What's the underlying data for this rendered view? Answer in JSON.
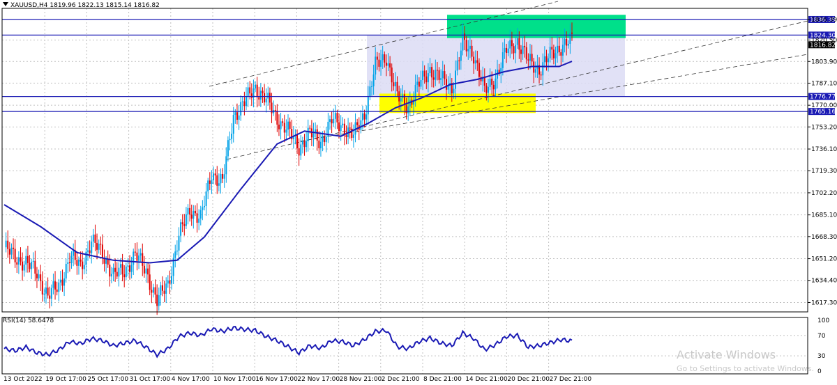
{
  "header": {
    "symbol": "XAUUSD,H4",
    "ohlc": [
      "1819.96",
      "1822.13",
      "1815.14",
      "1816.82"
    ]
  },
  "rsi": {
    "label": "RSI(14) 58.6478",
    "levels": [
      100,
      70,
      30,
      0
    ]
  },
  "watermark": {
    "title": "Activate Windows",
    "subtitle": "Go to Settings to activate Windows."
  },
  "chart_data": {
    "type": "candlestick",
    "price_axis": {
      "ylim": [
        1610,
        1845
      ],
      "ticks": [
        "1836.39",
        "1820.50",
        "1803.90",
        "1787.10",
        "1770.00",
        "1753.20",
        "1736.10",
        "1719.30",
        "1702.20",
        "1685.10",
        "1668.30",
        "1651.20",
        "1634.40",
        "1617.30"
      ]
    },
    "current_price": "1816.82",
    "horizontal_lines": [
      {
        "value": 1836.39,
        "label": "1836.39"
      },
      {
        "value": 1824.3,
        "label": "1824.30"
      },
      {
        "value": 1776.77,
        "label": "1776.77"
      },
      {
        "value": 1765.16,
        "label": "1765.16"
      }
    ],
    "x_labels": [
      "13 Oct 2022",
      "19 Oct 17:00",
      "25 Oct 17:00",
      "31 Oct 17:00",
      "4 Nov 17:00",
      "10 Nov 17:00",
      "16 Nov 17:00",
      "22 Nov 17:00",
      "28 Nov 21:00",
      "2 Dec 21:00",
      "8 Dec 21:00",
      "14 Dec 21:00",
      "20 Dec 21:00",
      "27 Dec 21:00"
    ],
    "colors": {
      "up": "#00a2e8",
      "down": "#e00000",
      "ma": "#1a1ab4",
      "hline": "#1a1ab4",
      "green_zone": "#00e08a",
      "yellow_zone": "#ffff00",
      "range_box": "#dcdcf5"
    },
    "close_path": [
      [
        0,
        1660
      ],
      [
        6,
        1652
      ],
      [
        12,
        1648
      ],
      [
        18,
        1640
      ],
      [
        24,
        1622
      ],
      [
        30,
        1630
      ],
      [
        36,
        1652
      ],
      [
        42,
        1646
      ],
      [
        48,
        1664
      ],
      [
        54,
        1656
      ],
      [
        60,
        1638
      ],
      [
        66,
        1642
      ],
      [
        72,
        1654
      ],
      [
        78,
        1642
      ],
      [
        84,
        1618
      ],
      [
        90,
        1632
      ],
      [
        96,
        1668
      ],
      [
        102,
        1690
      ],
      [
        108,
        1682
      ],
      [
        114,
        1718
      ],
      [
        120,
        1710
      ],
      [
        126,
        1762
      ],
      [
        132,
        1772
      ],
      [
        138,
        1784
      ],
      [
        144,
        1774
      ],
      [
        150,
        1760
      ],
      [
        156,
        1750
      ],
      [
        162,
        1738
      ],
      [
        168,
        1748
      ],
      [
        174,
        1742
      ],
      [
        180,
        1758
      ],
      [
        186,
        1754
      ],
      [
        192,
        1746
      ],
      [
        198,
        1764
      ],
      [
        204,
        1800
      ],
      [
        210,
        1808
      ],
      [
        216,
        1776
      ],
      [
        222,
        1770
      ],
      [
        228,
        1786
      ],
      [
        234,
        1798
      ],
      [
        240,
        1790
      ],
      [
        246,
        1784
      ],
      [
        252,
        1818
      ],
      [
        258,
        1810
      ],
      [
        264,
        1780
      ],
      [
        270,
        1792
      ],
      [
        276,
        1812
      ],
      [
        282,
        1820
      ],
      [
        288,
        1804
      ],
      [
        294,
        1798
      ],
      [
        300,
        1808
      ],
      [
        306,
        1816
      ],
      [
        312,
        1820
      ]
    ],
    "ma_path": [
      [
        0,
        1693
      ],
      [
        20,
        1676
      ],
      [
        40,
        1656
      ],
      [
        60,
        1650
      ],
      [
        80,
        1648
      ],
      [
        95,
        1650
      ],
      [
        110,
        1668
      ],
      [
        130,
        1705
      ],
      [
        150,
        1740
      ],
      [
        165,
        1750
      ],
      [
        185,
        1746
      ],
      [
        200,
        1756
      ],
      [
        215,
        1768
      ],
      [
        230,
        1776
      ],
      [
        245,
        1786
      ],
      [
        260,
        1790
      ],
      [
        275,
        1796
      ],
      [
        290,
        1800
      ],
      [
        305,
        1800
      ],
      [
        312,
        1804
      ]
    ],
    "rsi_series": [
      [
        0,
        44
      ],
      [
        6,
        40
      ],
      [
        12,
        47
      ],
      [
        18,
        36
      ],
      [
        24,
        32
      ],
      [
        30,
        42
      ],
      [
        36,
        58
      ],
      [
        42,
        54
      ],
      [
        48,
        64
      ],
      [
        54,
        60
      ],
      [
        60,
        50
      ],
      [
        66,
        55
      ],
      [
        72,
        60
      ],
      [
        78,
        47
      ],
      [
        84,
        32
      ],
      [
        90,
        44
      ],
      [
        96,
        68
      ],
      [
        102,
        75
      ],
      [
        108,
        70
      ],
      [
        114,
        83
      ],
      [
        120,
        78
      ],
      [
        126,
        85
      ],
      [
        132,
        82
      ],
      [
        138,
        80
      ],
      [
        144,
        68
      ],
      [
        150,
        60
      ],
      [
        156,
        48
      ],
      [
        162,
        36
      ],
      [
        168,
        50
      ],
      [
        174,
        45
      ],
      [
        180,
        60
      ],
      [
        186,
        58
      ],
      [
        192,
        50
      ],
      [
        198,
        62
      ],
      [
        204,
        78
      ],
      [
        210,
        80
      ],
      [
        216,
        48
      ],
      [
        222,
        44
      ],
      [
        228,
        58
      ],
      [
        234,
        65
      ],
      [
        240,
        55
      ],
      [
        246,
        50
      ],
      [
        252,
        75
      ],
      [
        258,
        64
      ],
      [
        264,
        42
      ],
      [
        270,
        52
      ],
      [
        276,
        68
      ],
      [
        282,
        70
      ],
      [
        288,
        47
      ],
      [
        294,
        50
      ],
      [
        300,
        56
      ],
      [
        306,
        62
      ],
      [
        312,
        59
      ]
    ]
  }
}
